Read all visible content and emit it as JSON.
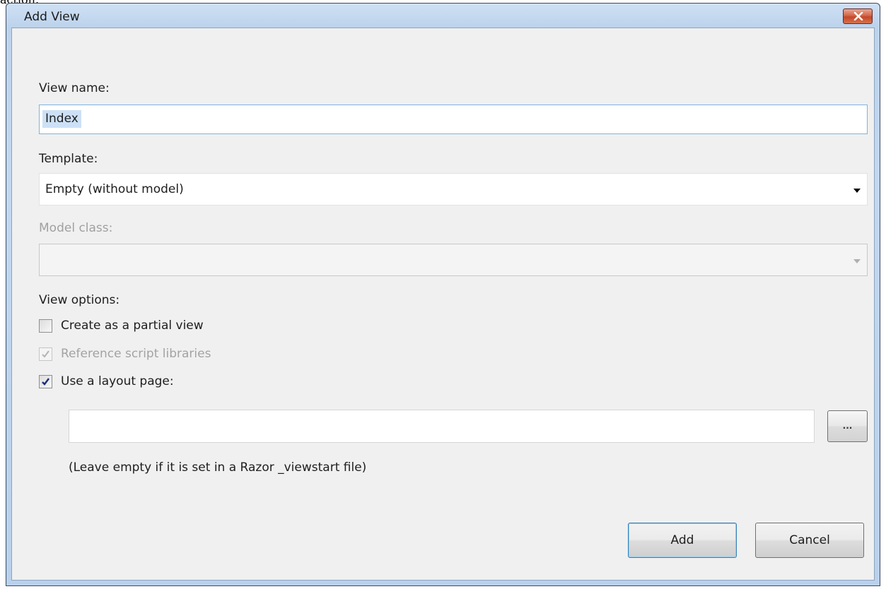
{
  "background_caption": "action.",
  "window": {
    "title": "Add View",
    "close_icon": "close-x-icon"
  },
  "form": {
    "view_name_label": "View name:",
    "view_name_value": "Index",
    "template_label": "Template:",
    "template_value": "Empty (without model)",
    "model_class_label": "Model class:",
    "model_class_value": "",
    "view_options_label": "View options:",
    "options": [
      {
        "label": "Create as a partial view",
        "checked": false,
        "enabled": true
      },
      {
        "label": "Reference script libraries",
        "checked": true,
        "enabled": false
      },
      {
        "label": "Use a layout page:",
        "checked": true,
        "enabled": true
      }
    ],
    "layout_page_value": "",
    "browse_label": "...",
    "layout_hint": "(Leave empty if it is set in a Razor _viewstart file)"
  },
  "buttons": {
    "add_label": "Add",
    "cancel_label": "Cancel"
  },
  "colors": {
    "selection": "#cde1f6",
    "focus_border": "#7fb3e0",
    "close_button": "#c44627",
    "check_mark": "#1c2c7a"
  }
}
